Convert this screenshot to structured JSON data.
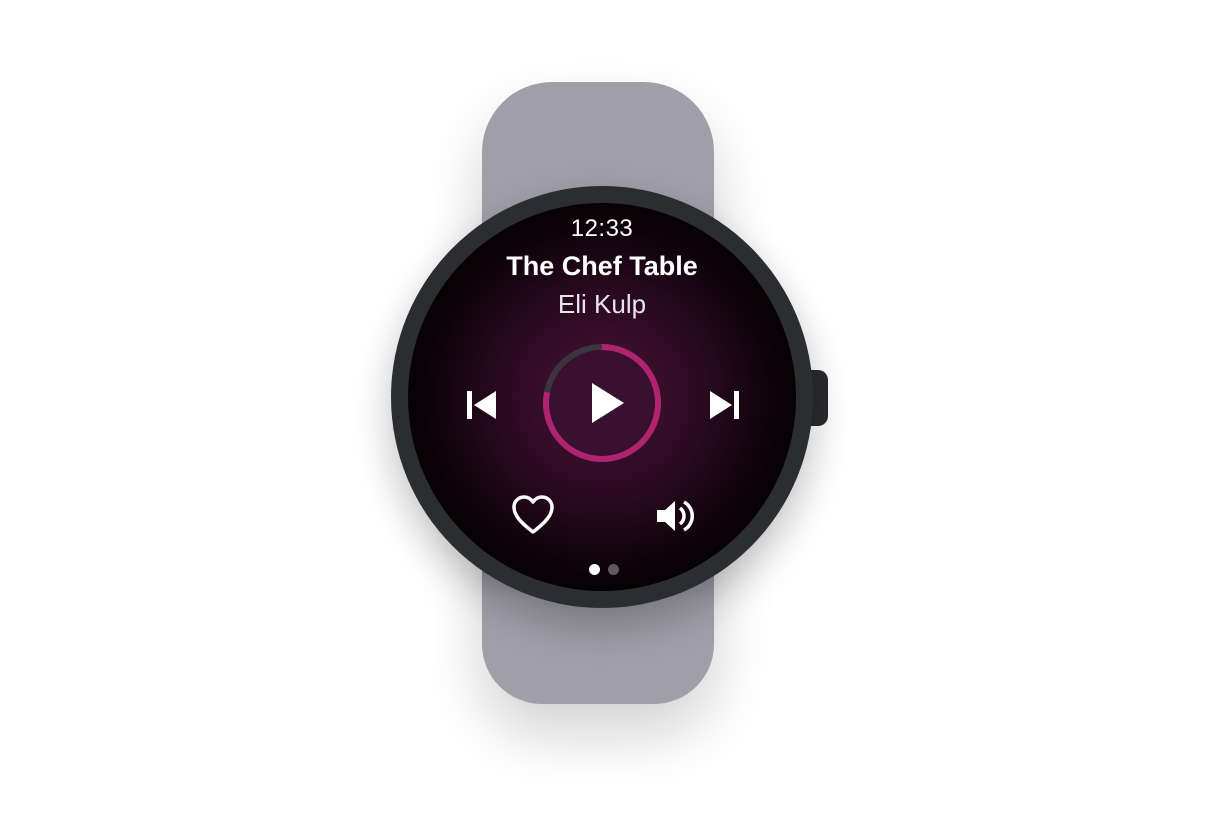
{
  "watch": {
    "time": "12:33",
    "now_playing": {
      "title": "The Chef Table",
      "artist": "Eli Kulp",
      "progress_fraction": 0.78
    },
    "controls": {
      "previous_icon": "skip-previous-icon",
      "play_icon": "play-icon",
      "next_icon": "skip-next-icon",
      "favorite_icon": "heart-icon",
      "volume_icon": "volume-icon"
    },
    "pager": {
      "page_count": 2,
      "current_page": 1
    },
    "colors": {
      "accent": "#b0246f",
      "band": "#a09fa9",
      "bezel": "#2c2d31"
    }
  }
}
